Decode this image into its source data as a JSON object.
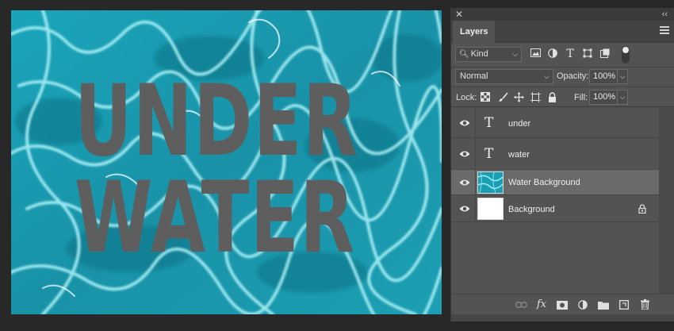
{
  "canvas": {
    "text_line1": "UNDER",
    "text_line2": "WATER"
  },
  "panel": {
    "close_glyph": "✕",
    "collapse_glyph": "‹‹",
    "tab_label": "Layers",
    "filter": {
      "kind_label": "Kind",
      "icons": [
        "image-filter-icon",
        "adjustment-filter-icon",
        "type-filter-icon",
        "shape-filter-icon",
        "smart-object-filter-icon"
      ]
    },
    "blend": {
      "mode": "Normal",
      "opacity_label": "Opacity:",
      "opacity_value": "100%"
    },
    "lock": {
      "label": "Lock:",
      "fill_label": "Fill:",
      "fill_value": "100%"
    },
    "layers": [
      {
        "name": "under",
        "kind": "type",
        "selected": false,
        "locked": false
      },
      {
        "name": "water",
        "kind": "type",
        "selected": false,
        "locked": false
      },
      {
        "name": "Water Background",
        "kind": "image",
        "selected": true,
        "locked": false
      },
      {
        "name": "Background",
        "kind": "white",
        "selected": false,
        "locked": true
      }
    ],
    "bottom_icons": [
      "link-icon",
      "fx-icon",
      "mask-icon",
      "adjustment-icon",
      "folder-icon",
      "new-layer-icon",
      "trash-icon"
    ],
    "fx_label": "fx"
  },
  "colors": {
    "water": "#1f9cb0",
    "text_gray": "#5e5e5e",
    "panel_bg": "#535353",
    "selected_layer": "#6a6a6a"
  }
}
